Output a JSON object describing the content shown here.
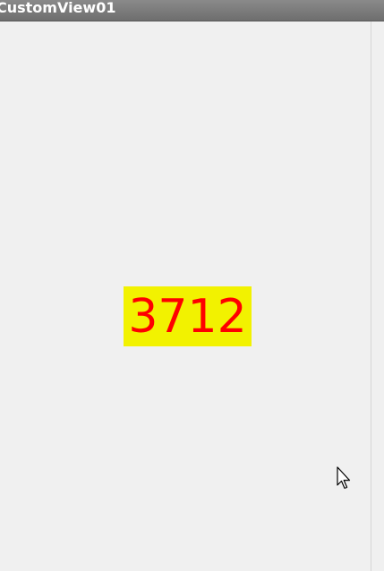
{
  "window": {
    "title": "CustomView01"
  },
  "custom_view": {
    "number": "3712",
    "text_color": "#ff0000",
    "background_color": "#f2f200"
  },
  "icons": {
    "cursor": "mouse-pointer-icon"
  }
}
